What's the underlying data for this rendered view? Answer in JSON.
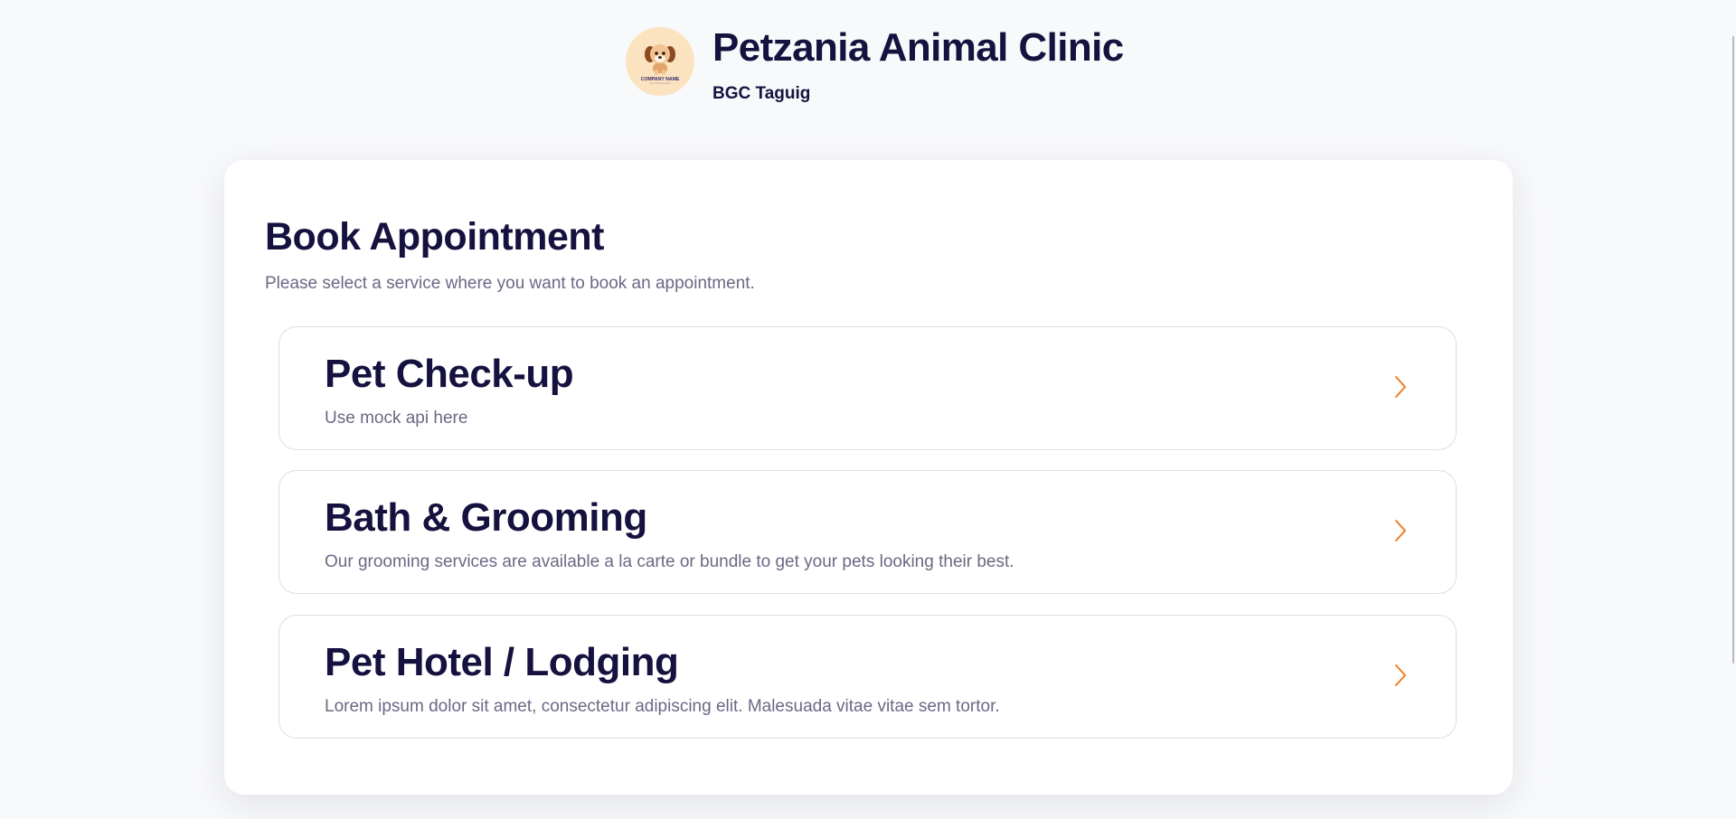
{
  "header": {
    "clinic_name": "Petzania Animal Clinic",
    "location": "BGC Taguig",
    "logo_text": "COMPANY NAME",
    "logo_icon": "dog-mascot-icon"
  },
  "booking": {
    "title": "Book Appointment",
    "subtitle": "Please select a service where you want to book an appointment."
  },
  "services": [
    {
      "title": "Pet Check-up",
      "description": "Use mock api here"
    },
    {
      "title": "Bath & Grooming",
      "description": "Our grooming services are available a la carte or bundle to get your pets looking their best."
    },
    {
      "title": "Pet Hotel / Lodging",
      "description": "Lorem ipsum dolor sit amet, consectetur adipiscing elit. Malesuada vitae vitae sem tortor."
    }
  ],
  "colors": {
    "background": "#f8f9fb",
    "text_primary": "#16123f",
    "text_muted": "#6b6885",
    "accent": "#f07c1e",
    "logo_bg": "#fbe3c0"
  }
}
